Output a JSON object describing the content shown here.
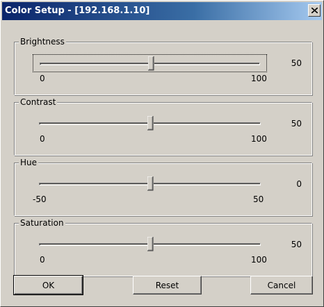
{
  "window": {
    "title": "Color Setup - [192.168.1.10]"
  },
  "controls": [
    {
      "label": "Brightness",
      "value": 50,
      "min": 0,
      "max": 100,
      "value_text": "50",
      "min_text": "0",
      "max_text": "100",
      "focused": true
    },
    {
      "label": "Contrast",
      "value": 50,
      "min": 0,
      "max": 100,
      "value_text": "50",
      "min_text": "0",
      "max_text": "100",
      "focused": false
    },
    {
      "label": "Hue",
      "value": 0,
      "min": -50,
      "max": 50,
      "value_text": "0",
      "min_text": "-50",
      "max_text": "50",
      "focused": false
    },
    {
      "label": "Saturation",
      "value": 50,
      "min": 0,
      "max": 100,
      "value_text": "50",
      "min_text": "0",
      "max_text": "100",
      "focused": false
    }
  ],
  "buttons": {
    "ok": "OK",
    "reset": "Reset",
    "cancel": "Cancel"
  },
  "icons": {
    "close": "close-icon"
  },
  "colors": {
    "title_bar_start": "#0a246a",
    "title_bar_end": "#a6caf0",
    "face": "#d4d0c8"
  }
}
